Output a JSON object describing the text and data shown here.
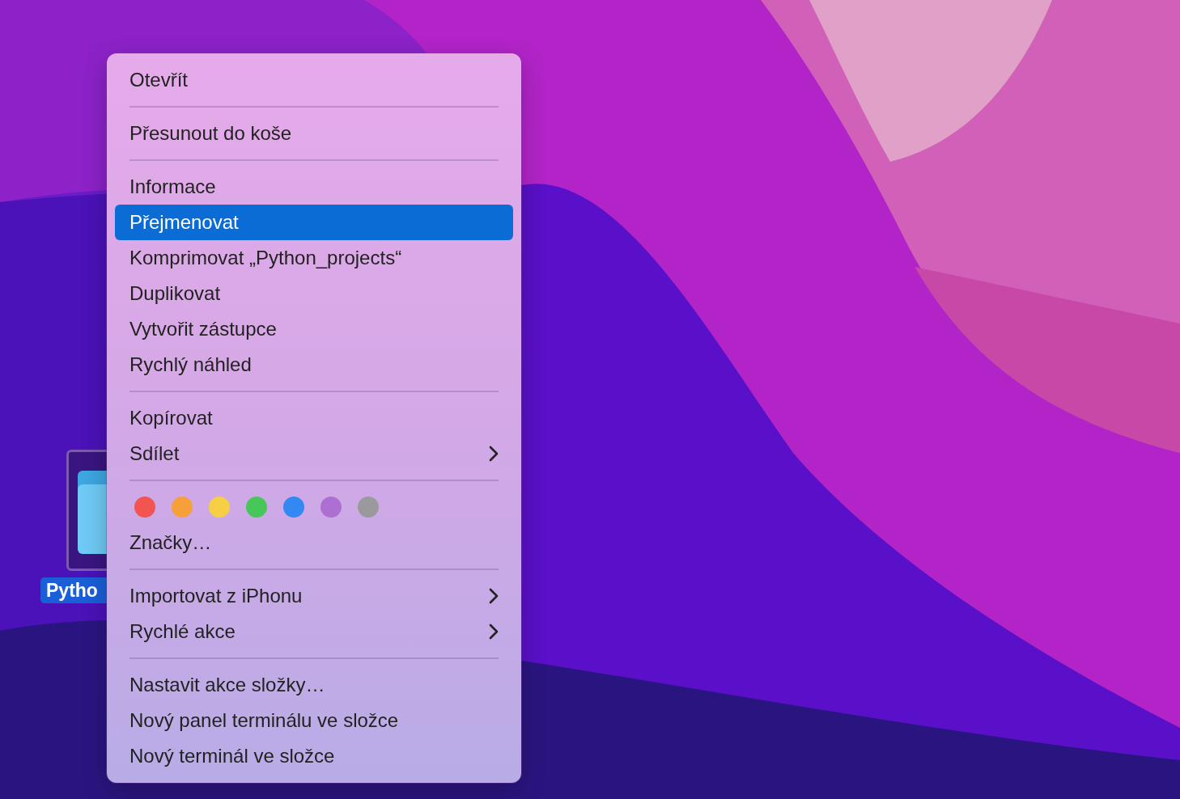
{
  "desktop_icon": {
    "label": "Pytho",
    "selected": true
  },
  "context_menu": {
    "sections": [
      [
        {
          "kind": "item",
          "label": "Otevřít",
          "selected": false,
          "submenu": false
        }
      ],
      [
        {
          "kind": "item",
          "label": "Přesunout do koše",
          "selected": false,
          "submenu": false
        }
      ],
      [
        {
          "kind": "item",
          "label": "Informace",
          "selected": false,
          "submenu": false
        },
        {
          "kind": "item",
          "label": "Přejmenovat",
          "selected": true,
          "submenu": false
        },
        {
          "kind": "item",
          "label": "Komprimovat „Python_projects“",
          "selected": false,
          "submenu": false
        },
        {
          "kind": "item",
          "label": "Duplikovat",
          "selected": false,
          "submenu": false
        },
        {
          "kind": "item",
          "label": "Vytvořit zástupce",
          "selected": false,
          "submenu": false
        },
        {
          "kind": "item",
          "label": "Rychlý náhled",
          "selected": false,
          "submenu": false
        }
      ],
      [
        {
          "kind": "item",
          "label": "Kopírovat",
          "selected": false,
          "submenu": false
        },
        {
          "kind": "item",
          "label": "Sdílet",
          "selected": false,
          "submenu": true
        }
      ],
      [
        {
          "kind": "tags",
          "colors": [
            {
              "color": "#f25451"
            },
            {
              "color": "#f6a03c"
            },
            {
              "color": "#f7cf45"
            },
            {
              "color": "#47c65a"
            },
            {
              "color": "#3388f2"
            },
            {
              "color": "#ad6fd2"
            },
            {
              "color": "#9a9a9e"
            }
          ]
        },
        {
          "kind": "item",
          "label": "Značky…",
          "selected": false,
          "submenu": false
        }
      ],
      [
        {
          "kind": "item",
          "label": "Importovat z iPhonu",
          "selected": false,
          "submenu": true
        },
        {
          "kind": "item",
          "label": "Rychlé akce",
          "selected": false,
          "submenu": true
        }
      ],
      [
        {
          "kind": "item",
          "label": "Nastavit akce složky…",
          "selected": false,
          "submenu": false
        },
        {
          "kind": "item",
          "label": "Nový panel terminálu ve složce",
          "selected": false,
          "submenu": false
        },
        {
          "kind": "item",
          "label": "Nový terminál ve složce",
          "selected": false,
          "submenu": false
        }
      ]
    ]
  }
}
